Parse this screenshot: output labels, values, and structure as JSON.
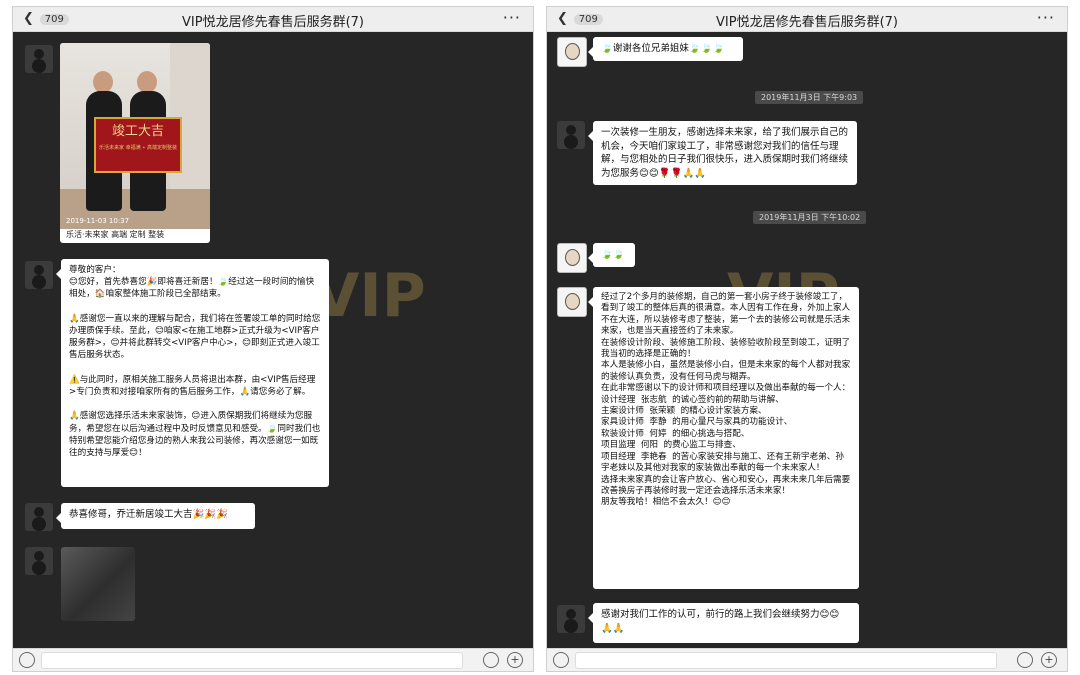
{
  "header": {
    "back_count": "709",
    "title": "VIP悦龙居修先春售后服务群(7)",
    "more": "···"
  },
  "left": {
    "photo": {
      "banner_text": "竣工大吉",
      "banner_small": "乐活未来家 幸福满 ∙ 高端定制整装",
      "timestamp": "2019-11-03 10:37",
      "caption": "乐活·未来家 高端 定制 整装"
    },
    "msg1": "尊敬的客户：\n😊您好，首先恭喜您🎉即将喜迁新居！🍃经过这一段时间的愉快相处，🏠咱家整体施工阶段已全部结束。\n\n🙏感谢您一直以来的理解与配合，我们将在签署竣工单的同时给您办理质保手续。至此，😊咱家<在施工地群>正式升级为<VIP客户服务群>，😊并将此群转交<VIP客户中心>，😊即刻正式进入竣工售后服务状态。\n\n⚠️与此同时，原相关施工服务人员将退出本群，由<VIP售后经理>专门负责和对接咱家所有的售后服务工作，🙏请您务必了解。\n\n🙏感谢您选择乐活未来家装饰，😊进入质保期我们将继续为您服务，希望您在以后沟通过程中及时反馈意见和感受。🍃同时我们也特别希望您能介绍您身边的熟人来我公司装修，再次感谢您一如既往的支持与厚爱😊！",
    "msg2": "恭喜修哥，乔迁新居竣工大吉🎉🎉🎉"
  },
  "right": {
    "msg1": "🍃谢谢各位兄弟姐妹🍃🍃🍃",
    "time1": "2019年11月3日 下午9:03",
    "msg2": "一次装修一生朋友，感谢选择未来家，给了我们展示自己的机会，今天咱们家竣工了，非常感谢您对我们的信任与理解，与您相处的日子我们很快乐，进入质保期时我们将继续为您服务😊😊🌹🌹🙏🙏",
    "time2": "2019年11月3日 下午10:02",
    "msg3": "🍃🍃",
    "msg4": "经过了2个多月的装修期，自己的第一套小房子终于装修竣工了，看到了竣工的整体后真的很满意。本人因有工作在身，外加上家人不在大连，所以装修考虑了整装，第一个去的装修公司就是乐活未来家，也是当天直接签约了未来家。\n在装修设计阶段、装修施工阶段、装修验收阶段至到竣工，证明了我当初的选择是正确的！\n本人是装修小白，虽然是装修小白，但是未来家的每个人都对我家的装修认真负责，没有任何马虎与糊弄。\n在此非常感谢以下的设计师和项目经理以及做出奉献的每一个人：\n设计经理  张志航  的诚心签约前的帮助与讲解、\n主案设计师  张荣颖  的精心设计家装方案、\n家具设计师  李静  的用心量尺与家具的功能设计、\n软装设计师  何婷  的细心挑选与搭配、\n项目监理  何阳  的费心监工与排查、\n项目经理  李艳春  的苦心家装安排与施工、还有王新宇老弟、孙宇老妹以及其他对我家的家装做出奉献的每一个未来家人！\n选择未来家真的会让客户放心、省心和安心，再来未来几年后需要改善换房子再装修时我一定还会选择乐活未来家！\n朋友等我哈！相信不会太久！😊😊",
    "msg5": "感谢对我们工作的认可，前行的路上我们会继续努力😊😊🙏🙏"
  },
  "bg_text": "VIP"
}
